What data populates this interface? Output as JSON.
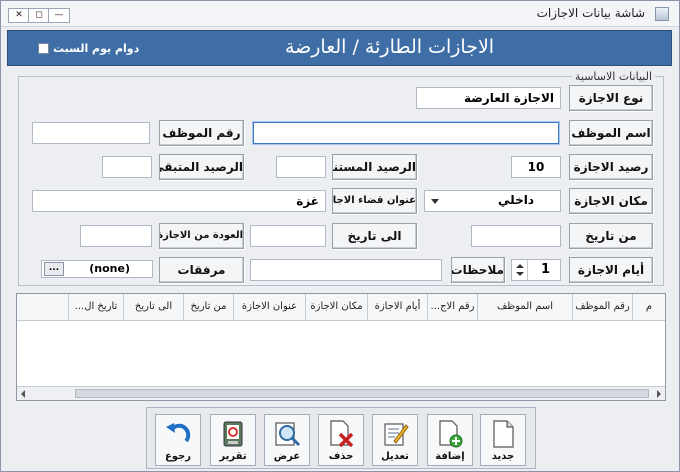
{
  "window": {
    "title": "شاشة بيانات الاجازات",
    "controls": {
      "close": "✕",
      "maximize": "◻",
      "minimize": "—"
    }
  },
  "header": {
    "title": "الاجازات الطارئة / العارضة",
    "saturday_label": "دوام يوم السبت",
    "saturday_checked": false
  },
  "basic_info": {
    "legend": "البيانات الاساسية",
    "leave_type_label": "نوع الاجازة",
    "leave_type_value": "الاجازة العارضة",
    "employee_number_label": "رقم الموظف",
    "employee_number_value": "",
    "employee_name_label": "اسم الموظف",
    "employee_name_value": "",
    "leave_balance_label": "رصيد الاجازة",
    "leave_balance_value": "10",
    "used_balance_label": "الرصيد المستنفذ",
    "used_balance_value": "",
    "remaining_balance_label": "الرصيد المتبقي",
    "remaining_balance_value": "",
    "leave_place_label": "مكان الاجازة",
    "leave_place_value": "داخلي",
    "leave_address_label": "عنوان قضاء الاجازة",
    "leave_address_value": "غزة",
    "from_date_label": "من تاريخ",
    "from_date_value": "",
    "to_date_label": "الى تاريخ",
    "to_date_value": "",
    "return_label": "العودة من الاجازة",
    "return_value": "",
    "leave_days_label": "أيام الاجازة",
    "leave_days_value": "1",
    "notes_label": "ملاحظات",
    "notes_value": "",
    "attachments_label": "مرفقات",
    "attachments_value": "(none)",
    "attachments_button": "..."
  },
  "grid": {
    "columns": [
      "م",
      "رقم الموظف",
      "اسم الموظف",
      "رقم الاج...",
      "أيام الاجازة",
      "مكان الاجازة",
      "عنوان الاجازة",
      "من تاريخ",
      "الى تاريخ",
      "تاريخ ال..."
    ]
  },
  "toolbar": {
    "new": "جديد",
    "add": "إضافة",
    "edit": "تعديل",
    "delete": "حذف",
    "view": "عرض",
    "report": "تقرير",
    "back": "رجوع"
  },
  "colors": {
    "banner": "#3f6ea6",
    "focus": "#3b78c4"
  }
}
